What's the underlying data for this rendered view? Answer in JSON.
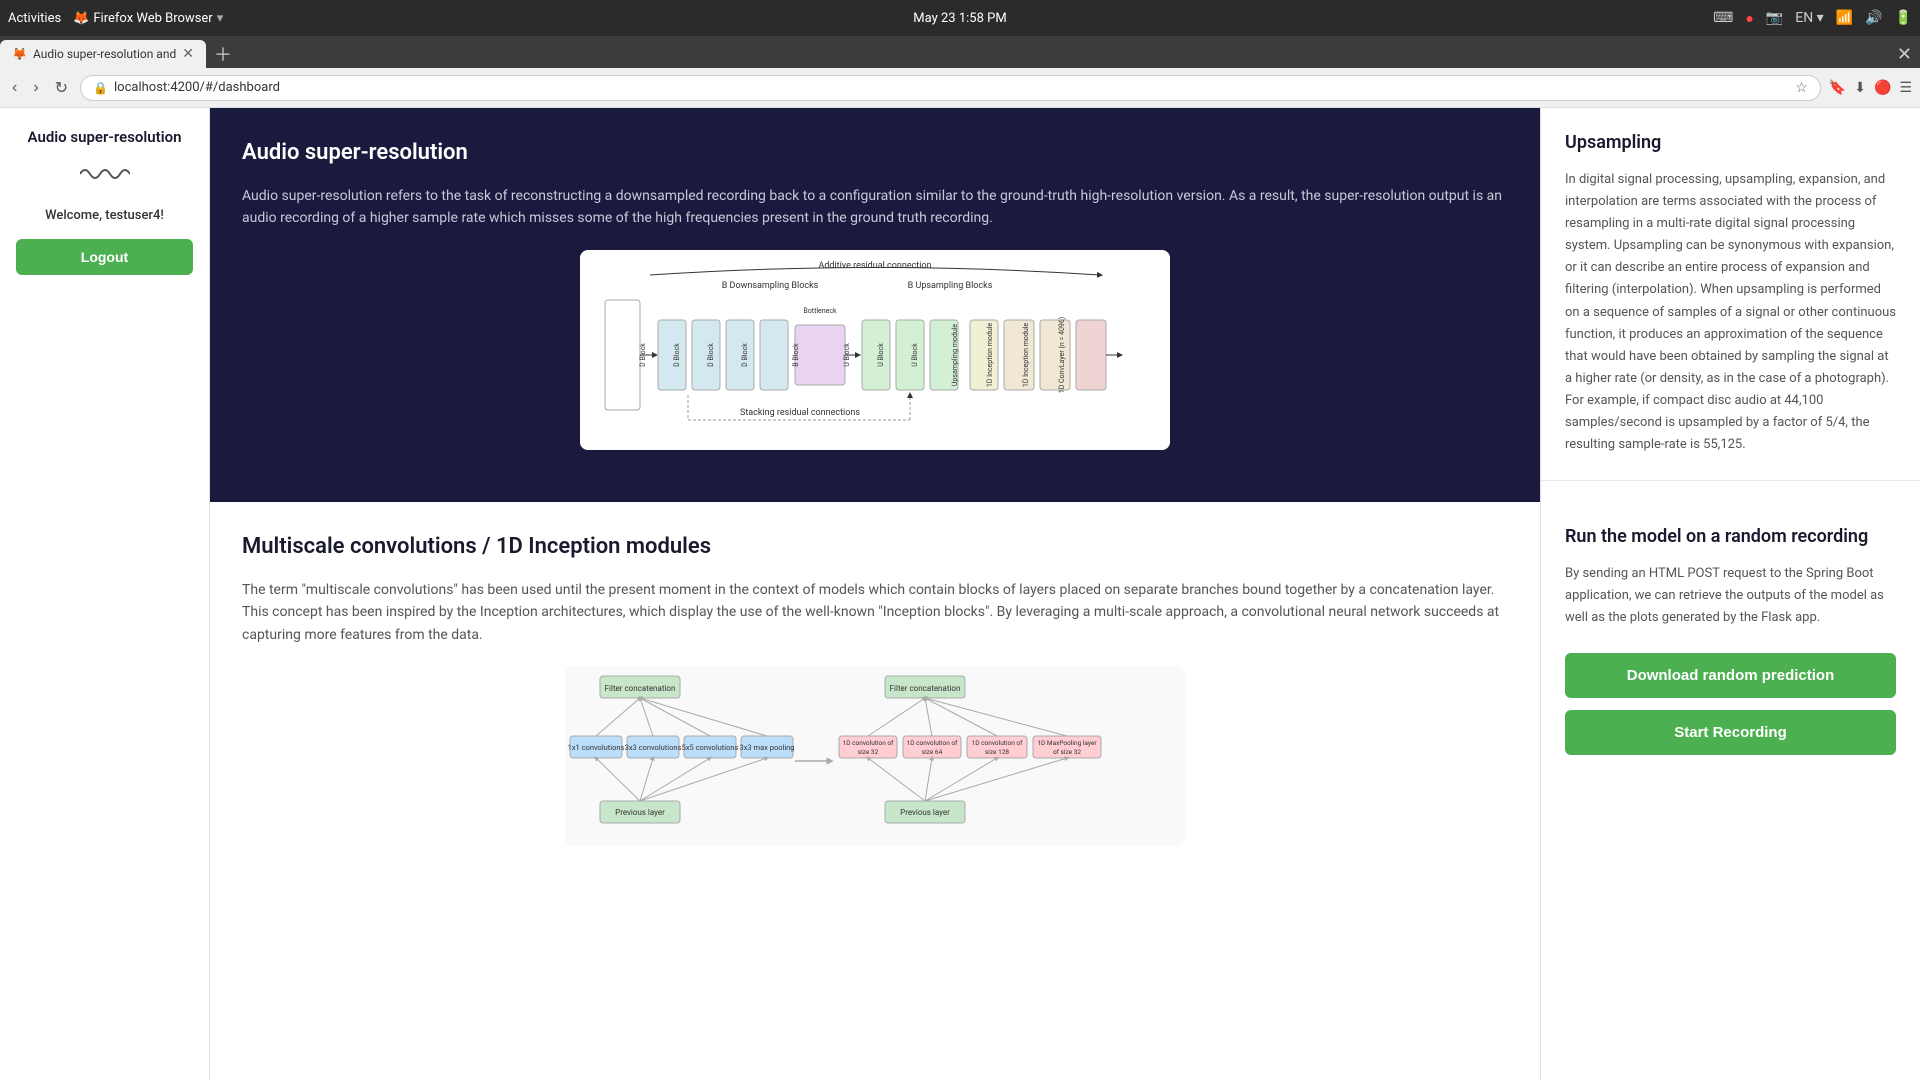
{
  "browser": {
    "topbar": {
      "activities": "Activities",
      "firefox": "Firefox Web Browser",
      "time": "May 23  1:58 PM"
    },
    "tab": {
      "title": "Audio super-resolution and",
      "favicon": "🦊"
    },
    "address": "localhost:4200/#/dashboard"
  },
  "sidebar": {
    "title": "Audio super-resolution",
    "icon": "〜",
    "welcome": "Welcome, testuser4!",
    "logout_label": "Logout"
  },
  "hero_section": {
    "title": "Audio super-resolution",
    "description": "Audio super-resolution refers to the task of reconstructing a downsampled recording back to a configuration similar to the ground-truth high-resolution version. As a result, the super-resolution output is an audio recording of a higher sample rate which misses some of the high frequencies present in the ground truth recording."
  },
  "upsampling_section": {
    "title": "Upsampling",
    "text": "In digital signal processing, upsampling, expansion, and interpolation are terms associated with the process of resampling in a multi-rate digital signal processing system. Upsampling can be synonymous with expansion, or it can describe an entire process of expansion and filtering (interpolation). When upsampling is performed on a sequence of samples of a signal or other continuous function, it produces an approximation of the sequence that would have been obtained by sampling the signal at a higher rate (or density, as in the case of a photograph). For example, if compact disc audio at 44,100 samples/second is upsampled by a factor of 5/4, the resulting sample-rate is 55,125."
  },
  "multiscale_section": {
    "title": "Multiscale convolutions / 1D Inception modules",
    "description": "The term \"multiscale convolutions\" has been used until the present moment in the context of models which contain blocks of layers placed on separate branches bound together by a concatenation layer. This concept has been inspired by the Inception architectures, which display the use of the well-known \"Inception blocks\". By leveraging a multi-scale approach, a convolutional neural network succeeds at capturing more features from the data."
  },
  "run_model_section": {
    "title": "Run the model on a random recording",
    "description": "By sending an HTML POST request to the Spring Boot application, we can retrieve the outputs of the model as well as the plots generated by the Flask app.",
    "download_btn": "Download random prediction",
    "record_btn": "Start Recording"
  }
}
